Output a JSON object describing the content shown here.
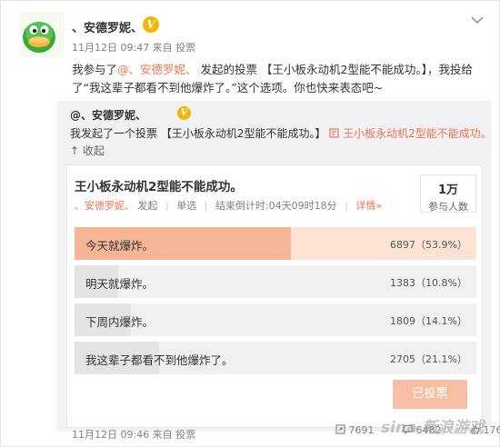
{
  "post": {
    "username": "、安德罗妮、",
    "verified": "V",
    "meta": "11月12日 09:47 来自 投票",
    "text_prefix": "我参与了",
    "mention": "@、安德罗妮、",
    "text_middle": " 发起的投票 【王小板永动机2型能不能成功。】，我投给了“我这辈子都看不到他爆炸了。”这个选项。你也快来表态吧~"
  },
  "repost": {
    "username": "@、安德罗妮、",
    "verified": "V",
    "text_prefix": "我发起了一个投票 【王小板永动机2型能不能成功。】",
    "link": "王小板永动机2型能不能成功。",
    "collapse": "↑ 收起"
  },
  "poll": {
    "title": "王小板永动机2型能不能成功。",
    "organizer": "、安德罗妮、",
    "organizer_suffix": "发起",
    "mode": "单选",
    "countdown": "结束倒计时:04天09时18分",
    "detail": "详情»",
    "participants_num": "1万",
    "participants_label": "参与人数",
    "options": [
      {
        "label": "今天就爆炸。",
        "value": "6897（53.9%）",
        "percent": 53.9
      },
      {
        "label": "明天就爆炸。",
        "value": "1383（10.8%）",
        "percent": 10.8
      },
      {
        "label": "下周内爆炸。",
        "value": "1809（14.1%）",
        "percent": 14.1
      },
      {
        "label": "我这辈子都看不到他爆炸了。",
        "value": "2705（21.1%）",
        "percent": 21.1
      }
    ],
    "voted_button": "已投票"
  },
  "footer": {
    "meta": "11月12日 09:46 来自 投票",
    "repost_count": "7691",
    "comment_count": "6482",
    "like_count": "176"
  },
  "watermark": "sina 新浪游戏",
  "colors": {
    "accent": "#eb7350",
    "top_option_fill": "#f7b597",
    "verified": "#f4b400"
  }
}
